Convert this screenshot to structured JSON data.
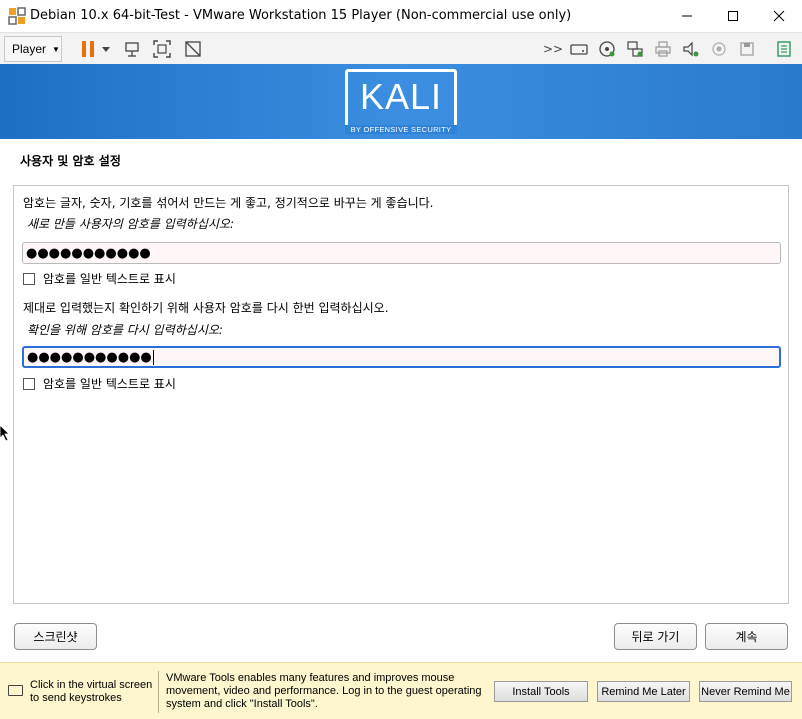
{
  "window": {
    "title": "Debian 10.x 64-bit-Test - VMware Workstation 15 Player (Non-commercial use only)",
    "minimize_glyph": "—",
    "maximize_glyph": "☐",
    "close_glyph": "✕"
  },
  "toolbar": {
    "player_label": "Player",
    "icons": [
      "pause-icon",
      "dropdown-caret-icon",
      "send-keys-icon",
      "fullscreen-icon",
      "unity-icon",
      "more-devices-icon",
      "hard-disk-icon",
      "cd-dvd-icon",
      "network-icon",
      "printer-icon",
      "sound-icon",
      "usb-icon",
      "floppy-icon",
      "notes-icon"
    ]
  },
  "installer": {
    "brand": "KALI",
    "brand_sub": "BY OFFENSIVE SECURITY",
    "section_title": "사용자 및 암호 설정",
    "intro": "암호는 글자, 숫자, 기호를 섞어서 만드는 게 좋고, 정기적으로 바꾸는 게 좋습니다.",
    "prompt1": "새로 만들 사용자의 암호를 입력하십시오:",
    "password1": "●●●●●●●●●●●",
    "show_password1": "암호를 일반 텍스트로 표시",
    "confirm_intro": "제대로 입력했는지 확인하기 위해 사용자 암호를 다시 한번 입력하십시오.",
    "prompt2": "확인을 위해 암호를 다시 입력하십시오:",
    "password2": "●●●●●●●●●●●",
    "show_password2": "암호를 일반 텍스트로 표시",
    "screenshot_button": "스크린샷",
    "back_button": "뒤로 가기",
    "continue_button": "계속"
  },
  "statusbar": {
    "hint": "Click in the virtual screen to send keystrokes",
    "tools_message": "VMware Tools enables many features and improves mouse movement, video and performance. Log in to the guest operating system and click \"Install Tools\".",
    "install_tools": "Install Tools",
    "remind_later": "Remind Me Later",
    "never_remind": "Never Remind Me"
  },
  "colors": {
    "banner": "#2a7acd",
    "toolbar_bg": "#f3f3f3",
    "status_bg": "#fdf6cf",
    "pause_orange": "#e8700a",
    "focus_border": "#2a6fd6"
  }
}
